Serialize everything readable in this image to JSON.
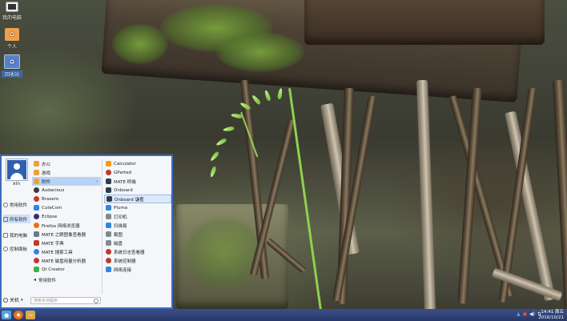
{
  "desktop": {
    "icons": [
      {
        "label": "我的电脑",
        "icon": "computer-icon"
      },
      {
        "label": "个人",
        "icon": "home-folder-icon"
      },
      {
        "label": "回收站",
        "icon": "trash-icon"
      }
    ]
  },
  "start_menu": {
    "user_name": "xin",
    "sidebar": [
      {
        "label": "常用软件"
      },
      {
        "label": "所有软件"
      },
      {
        "label": "我的电脑"
      },
      {
        "label": "控制面板"
      }
    ],
    "categories": [
      {
        "label": "办公",
        "color": "#e9a23b"
      },
      {
        "label": "游戏",
        "color": "#e9a23b"
      },
      {
        "label": "附件",
        "color": "#e9a23b",
        "has_submenu": true
      },
      {
        "label": "Audacious",
        "color": "#3b3b3b"
      },
      {
        "label": "Brasero",
        "color": "#c0392b"
      },
      {
        "label": "CuteCom",
        "color": "#2e86de"
      },
      {
        "label": "Eclipse",
        "color": "#3d2a6b"
      },
      {
        "label": "Firefox 网络浏览器",
        "color": "#e8711c"
      },
      {
        "label": "MATE 之眼图像查看器",
        "color": "#6c7a89"
      },
      {
        "label": "MATE 字典",
        "color": "#c0392b"
      },
      {
        "label": "MATE 搜索工具",
        "color": "#2e86de"
      },
      {
        "label": "MATE 磁盘用量分析器",
        "color": "#c0392b"
      },
      {
        "label": "Qt Creator",
        "color": "#41b141"
      },
      {
        "label": "常用软件",
        "color": "#555555",
        "is_back": true
      }
    ],
    "apps": [
      {
        "label": "Calculator",
        "color": "#f39c12"
      },
      {
        "label": "GParted",
        "color": "#c0392b"
      },
      {
        "label": "MATE 终端",
        "color": "#2c3e50"
      },
      {
        "label": "Onboard",
        "color": "#2c3e50"
      },
      {
        "label": "Onboard 设置",
        "color": "#2c3e50"
      },
      {
        "label": "Pluma",
        "color": "#2e86de"
      },
      {
        "label": "打印机",
        "color": "#7f8c8d"
      },
      {
        "label": "扫描易",
        "color": "#2e86de"
      },
      {
        "label": "截图",
        "color": "#7f8c8d"
      },
      {
        "label": "磁盘",
        "color": "#7f8c8d"
      },
      {
        "label": "系统日志查看器",
        "color": "#c0392b"
      },
      {
        "label": "系统控制器",
        "color": "#c0392b"
      },
      {
        "label": "网络连接",
        "color": "#2e86de"
      }
    ],
    "search_placeholder": "搜索本地程序",
    "shutdown_label": "关机"
  },
  "taskbar": {
    "clock_time": "14:41 周五",
    "clock_date": "2016/10/21"
  }
}
